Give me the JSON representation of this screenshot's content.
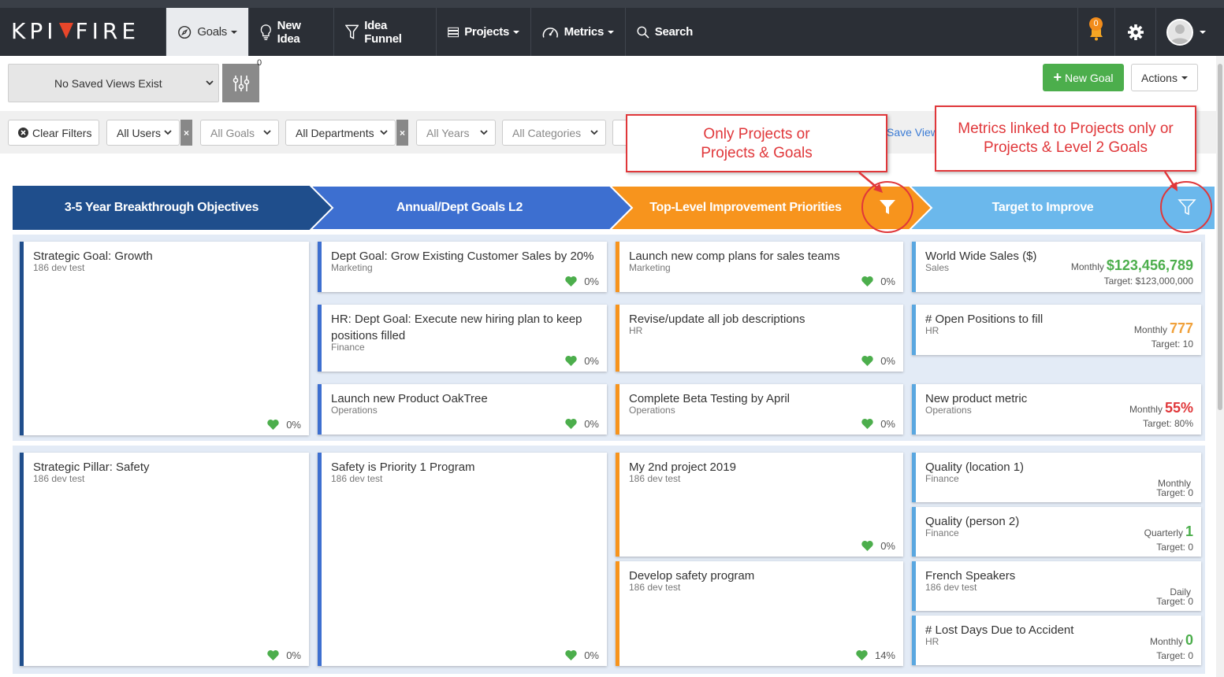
{
  "app": {
    "logo_left": "KPI",
    "logo_right": "FIRE",
    "nav": {
      "goals": "Goals",
      "new_idea": "New Idea",
      "idea_funnel": "Idea Funnel",
      "projects": "Projects",
      "metrics": "Metrics",
      "search": "Search"
    },
    "notification_count": "0"
  },
  "toolbar": {
    "saved_views": "No Saved Views Exist",
    "filter_count": "0",
    "new_goal": "New Goal",
    "actions": "Actions"
  },
  "filters": {
    "clear": "Clear Filters",
    "users": "All Users",
    "goals": "All Goals",
    "departments": "All Departments",
    "years": "All Years",
    "categories": "All Categories",
    "save_view": "Save View"
  },
  "columns": [
    {
      "title": "3-5 Year Breakthrough Objectives",
      "color": "#1f4e8c"
    },
    {
      "title": "Annual/Dept Goals L2",
      "color": "#3d6fd0"
    },
    {
      "title": "Top-Level Improvement Priorities",
      "color": "#f7941d"
    },
    {
      "title": "Target to Improve",
      "color": "#6bb8ec"
    }
  ],
  "callouts": {
    "projects": "Only Projects or Projects & Goals",
    "metrics": "Metrics linked to Projects only or Projects & Level 2 Goals"
  },
  "rows": [
    {
      "objective": {
        "title": "Strategic Goal: Growth",
        "sub": "186 dev test",
        "progress": "0%"
      },
      "goals": [
        {
          "title": "Dept Goal: Grow Existing Customer Sales by 20%",
          "sub": "Marketing",
          "progress": "0%"
        },
        {
          "title": "HR: Dept Goal: Execute new hiring plan to keep positions filled",
          "sub": "Finance",
          "progress": "0%"
        },
        {
          "title": "Launch new Product OakTree",
          "sub": "Operations",
          "progress": "0%"
        }
      ],
      "projects": [
        {
          "title": "Launch new comp plans for sales teams",
          "sub": "Marketing",
          "progress": "0%"
        },
        {
          "title": "Revise/update all job descriptions",
          "sub": "HR",
          "progress": "0%"
        },
        {
          "title": "Complete Beta Testing by April",
          "sub": "Operations",
          "progress": "0%"
        }
      ],
      "metrics": [
        {
          "title": "World Wide Sales ($)",
          "sub": "Sales",
          "freq": "Monthly",
          "value": "$123,456,789",
          "value_color": "#4cae4c",
          "target": "Target: $123,000,000"
        },
        {
          "title": "# Open Positions to fill",
          "sub": "HR",
          "freq": "Monthly",
          "value": "777",
          "value_color": "#f0a13b",
          "target": "Target: 10"
        },
        {
          "title": "New product metric",
          "sub": "Operations",
          "freq": "Monthly",
          "value": "55%",
          "value_color": "#e0373a",
          "target": "Target: 80%"
        }
      ]
    },
    {
      "objective": {
        "title": "Strategic Pillar: Safety",
        "sub": "186 dev test",
        "progress": "0%"
      },
      "goals": [
        {
          "title": "Safety is Priority 1 Program",
          "sub": "186 dev test",
          "progress": "0%"
        }
      ],
      "projects": [
        {
          "title": "My 2nd project 2019",
          "sub": "186 dev test",
          "progress": "0%"
        },
        {
          "title": "Develop safety program",
          "sub": "186 dev test",
          "progress": "14%"
        }
      ],
      "metrics": [
        {
          "title": "Quality (location 1)",
          "sub": "Finance",
          "freq": "Monthly",
          "value": "",
          "value_color": "#4cae4c",
          "target": "Target: 0"
        },
        {
          "title": "Quality (person 2)",
          "sub": "Finance",
          "freq": "Quarterly",
          "value": "1",
          "value_color": "#4cae4c",
          "target": "Target: 0"
        },
        {
          "title": "French Speakers",
          "sub": "186 dev test",
          "freq": "Daily",
          "value": "",
          "value_color": "#4cae4c",
          "target": "Target: 0"
        },
        {
          "title": "# Lost Days Due to Accident",
          "sub": "HR",
          "freq": "Monthly",
          "value": "0",
          "value_color": "#4cae4c",
          "target": "Target: 0"
        }
      ]
    }
  ]
}
